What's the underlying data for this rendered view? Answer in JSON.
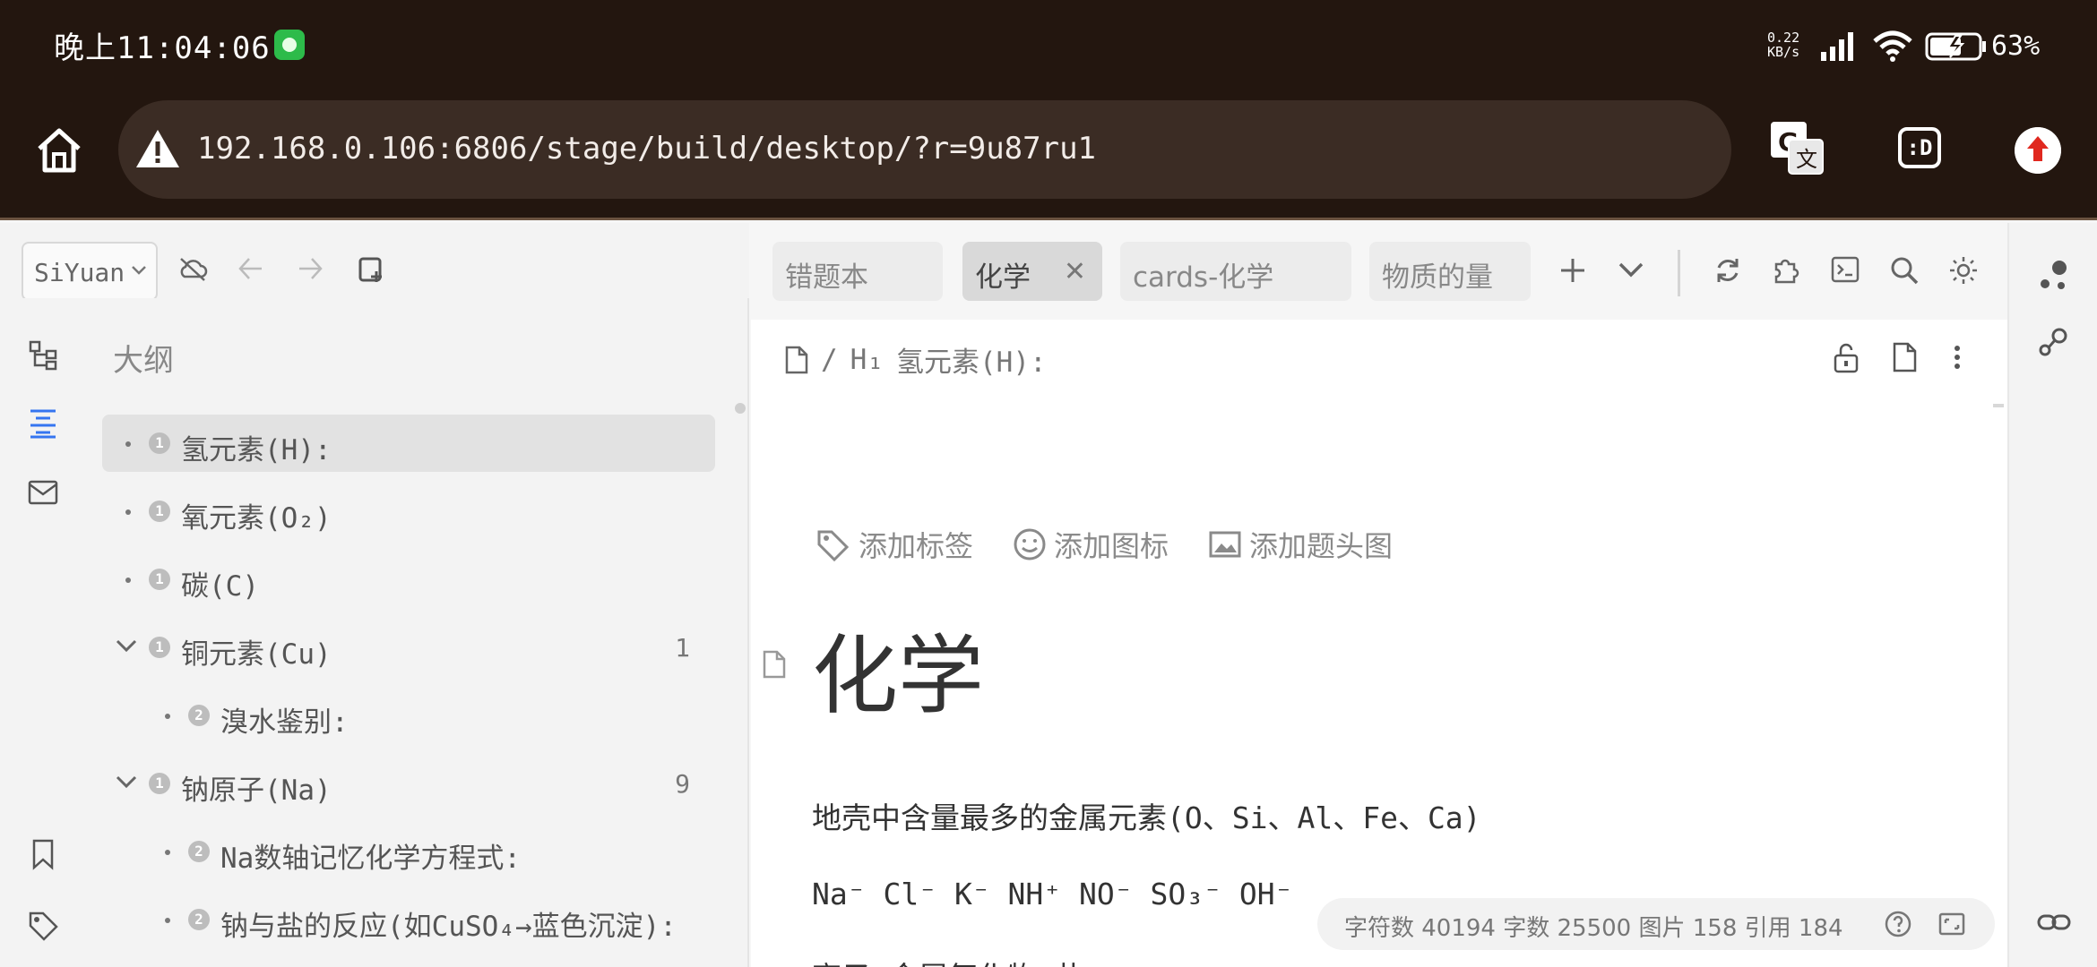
{
  "status_bar": {
    "time": "晚上11:04:06",
    "net_speed_value": "0.22",
    "net_speed_unit": "KB/s",
    "battery": "63%"
  },
  "browser": {
    "url": "192.168.0.106:6806/stage/build/desktop/?r=9u87ru1",
    "d_label": ":D"
  },
  "toolbar": {
    "workspace": "SiYuan"
  },
  "outline": {
    "title": "大纲",
    "items": [
      {
        "label": "氢元素(H):",
        "level": "1",
        "count": ""
      },
      {
        "label": "氧元素(O₂)",
        "level": "1",
        "count": ""
      },
      {
        "label": "碳(C)",
        "level": "1",
        "count": ""
      },
      {
        "label": "铜元素(Cu)",
        "level": "1",
        "count": "1"
      },
      {
        "label": "溴水鉴别:",
        "level": "2",
        "count": ""
      },
      {
        "label": "钠原子(Na)",
        "level": "1",
        "count": "9"
      },
      {
        "label": "Na数轴记忆化学方程式:",
        "level": "2",
        "count": ""
      },
      {
        "label": "钠与盐的反应(如CuSO₄→蓝色沉淀):",
        "level": "2",
        "count": ""
      }
    ]
  },
  "tabs": [
    {
      "label": "错题本"
    },
    {
      "label": "化学"
    },
    {
      "label": "cards-化学"
    },
    {
      "label": "物质的量"
    }
  ],
  "editor": {
    "breadcrumb_sep": "/",
    "breadcrumb_level": "H₁",
    "breadcrumb_heading": "氢元素(H):",
    "add_tag": "添加标签",
    "add_icon": "添加图标",
    "add_cover": "添加题头图",
    "title": "化学",
    "para1": "地壳中含量最多的金属元素(O、Si、Al、Fe、Ca)",
    "para2": "Na⁻ Cl⁻ K⁻ NH⁺ NO⁻ SO₃⁻ OH⁻",
    "para3": "离子 金属氧化物 盐"
  },
  "stats": {
    "text": "字符数 40194  字数 25500  图片 158  引用 184"
  },
  "colors": {
    "accent": "#3575f0",
    "browser_bg": "#23160f",
    "upload_red": "#e0281f"
  }
}
